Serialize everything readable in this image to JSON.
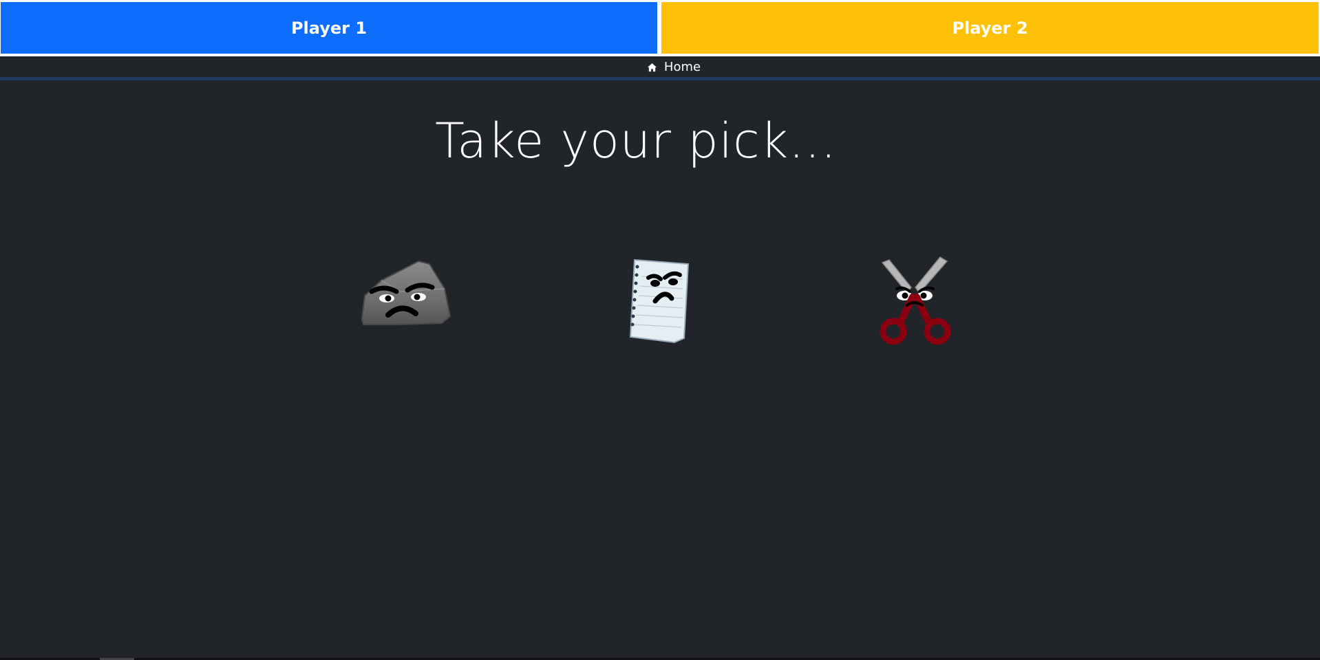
{
  "players": {
    "player1_label": "Player 1",
    "player2_label": "Player 2",
    "player1_color": "#0d6efd",
    "player2_color": "#ffc107"
  },
  "nav": {
    "home_icon": "home-icon",
    "home_label": "Home"
  },
  "main": {
    "title": "Take your pick...",
    "choices": [
      {
        "name": "rock",
        "icon": "rock-icon"
      },
      {
        "name": "paper",
        "icon": "paper-icon"
      },
      {
        "name": "scissors",
        "icon": "scissors-icon"
      }
    ]
  },
  "colors": {
    "background": "#212529",
    "rule": "#1f3a63"
  }
}
